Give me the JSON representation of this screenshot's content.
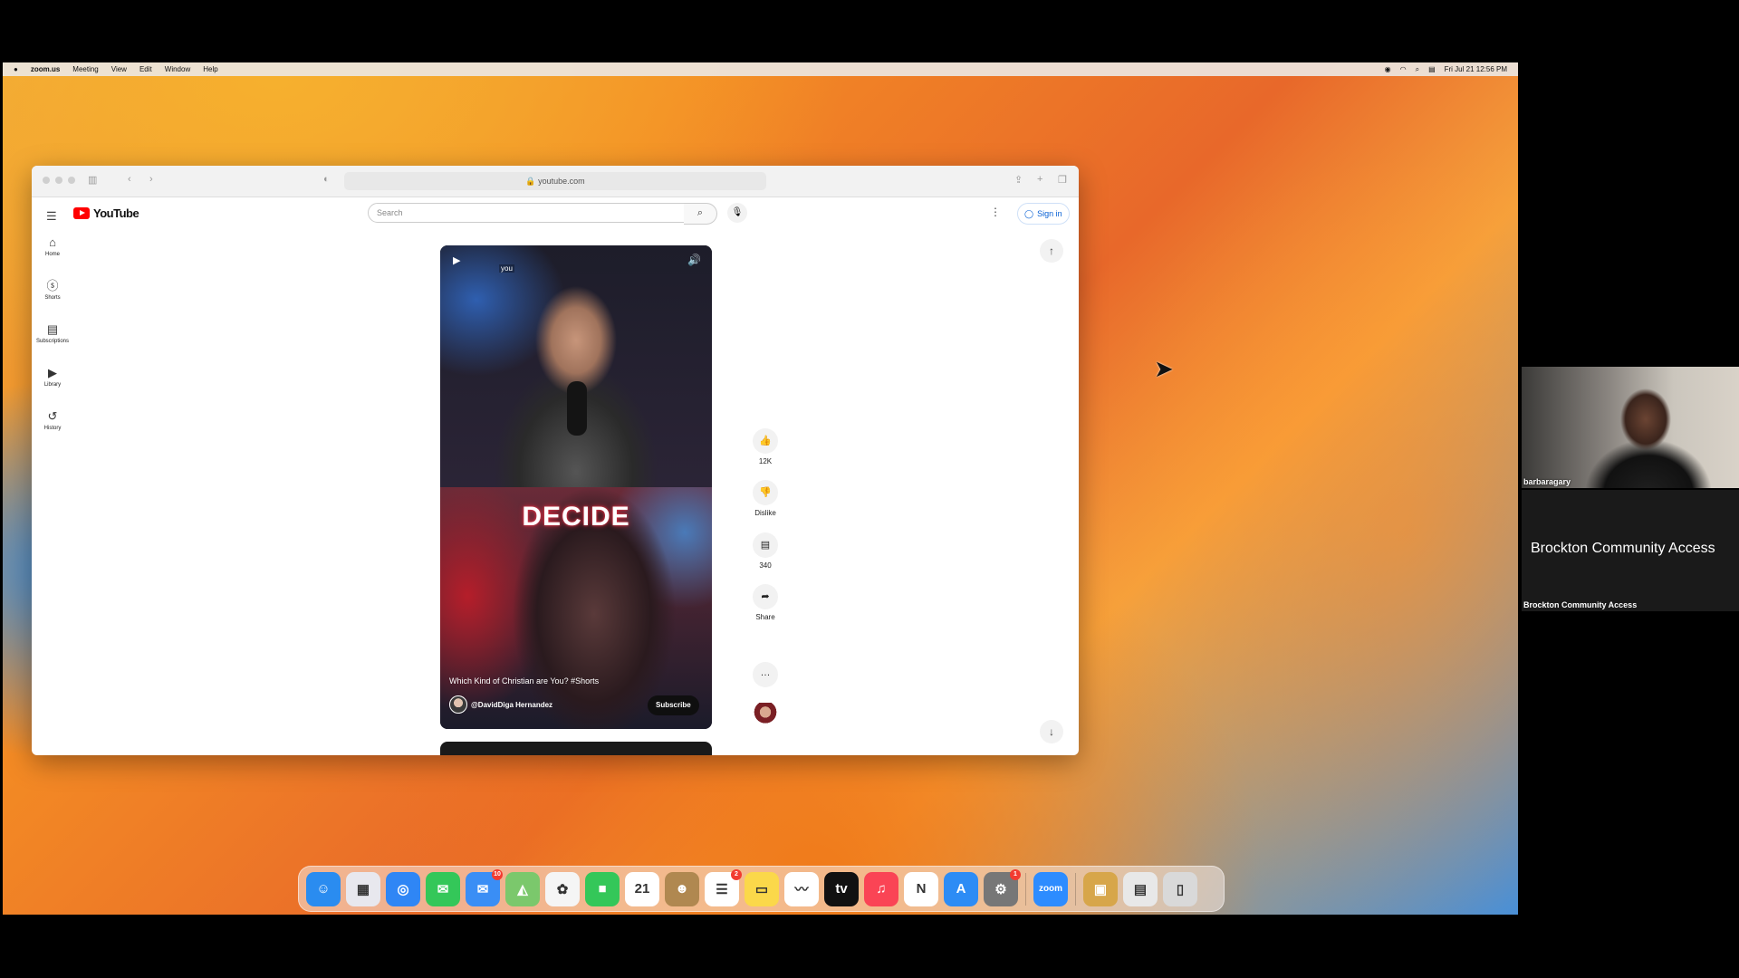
{
  "menubar": {
    "apple": "",
    "app_name": "zoom.us",
    "items": [
      "Meeting",
      "View",
      "Edit",
      "Window",
      "Help"
    ],
    "clock": "Fri Jul 21  12:56 PM"
  },
  "browser": {
    "url": "youtube.com"
  },
  "youtube": {
    "logo_text": "YouTube",
    "search_placeholder": "Search",
    "sign_in": "Sign in",
    "sidebar": [
      {
        "label": "Home",
        "icon": "home-icon",
        "glyph": "⌂"
      },
      {
        "label": "Shorts",
        "icon": "shorts-icon",
        "glyph": "ⓢ"
      },
      {
        "label": "Subscriptions",
        "icon": "subscriptions-icon",
        "glyph": "▤"
      },
      {
        "label": "Library",
        "icon": "library-icon",
        "glyph": "▶"
      },
      {
        "label": "History",
        "icon": "history-icon",
        "glyph": "↺"
      }
    ],
    "short": {
      "overlay_text": "DECIDE",
      "tag": "you",
      "title": "Which Kind of Christian are You? #Shorts",
      "channel": "@DavidDiga Hernandez",
      "subscribe": "Subscribe"
    },
    "actions": {
      "likes": "12K",
      "dislike": "Dislike",
      "comments": "340",
      "share": "Share"
    }
  },
  "dock": {
    "apps": [
      {
        "name": "finder",
        "color": "#2a8cf0",
        "glyph": "☺"
      },
      {
        "name": "launchpad",
        "color": "#e8e8ee",
        "glyph": "▦"
      },
      {
        "name": "safari",
        "color": "#2f86f5",
        "glyph": "◎"
      },
      {
        "name": "messages",
        "color": "#34c759",
        "glyph": "✉"
      },
      {
        "name": "mail",
        "color": "#3a8ef5",
        "glyph": "✉",
        "badge": "10"
      },
      {
        "name": "maps",
        "color": "#7bc86c",
        "glyph": "◭"
      },
      {
        "name": "photos",
        "color": "#f5f5f5",
        "glyph": "✿"
      },
      {
        "name": "facetime",
        "color": "#34c759",
        "glyph": "■"
      },
      {
        "name": "calendar",
        "color": "#ffffff",
        "glyph": "21"
      },
      {
        "name": "contacts",
        "color": "#b08850",
        "glyph": "☻"
      },
      {
        "name": "reminders",
        "color": "#ffffff",
        "glyph": "☰",
        "badge": "2"
      },
      {
        "name": "notes",
        "color": "#fbd84a",
        "glyph": "▭"
      },
      {
        "name": "freeform",
        "color": "#ffffff",
        "glyph": "〰"
      },
      {
        "name": "tv",
        "color": "#111111",
        "glyph": "tv"
      },
      {
        "name": "music",
        "color": "#fa4455",
        "glyph": "♫"
      },
      {
        "name": "news",
        "color": "#ffffff",
        "glyph": "N"
      },
      {
        "name": "app-store",
        "color": "#2d8cf5",
        "glyph": "A"
      },
      {
        "name": "system-settings",
        "color": "#777777",
        "glyph": "⚙",
        "badge": "1"
      },
      {
        "name": "zoom",
        "color": "#2d8cff",
        "glyph": "zoom"
      },
      {
        "name": "archive",
        "color": "#d7a64a",
        "glyph": "▣"
      },
      {
        "name": "documents",
        "color": "#e8e8e8",
        "glyph": "▤"
      },
      {
        "name": "trash",
        "color": "#d9d9d9",
        "glyph": "▯"
      }
    ]
  },
  "zoom": {
    "participant_name": "barbaragary",
    "tile_display_name": "Brockton Community Access",
    "tile_label": "Brockton Community Access"
  }
}
